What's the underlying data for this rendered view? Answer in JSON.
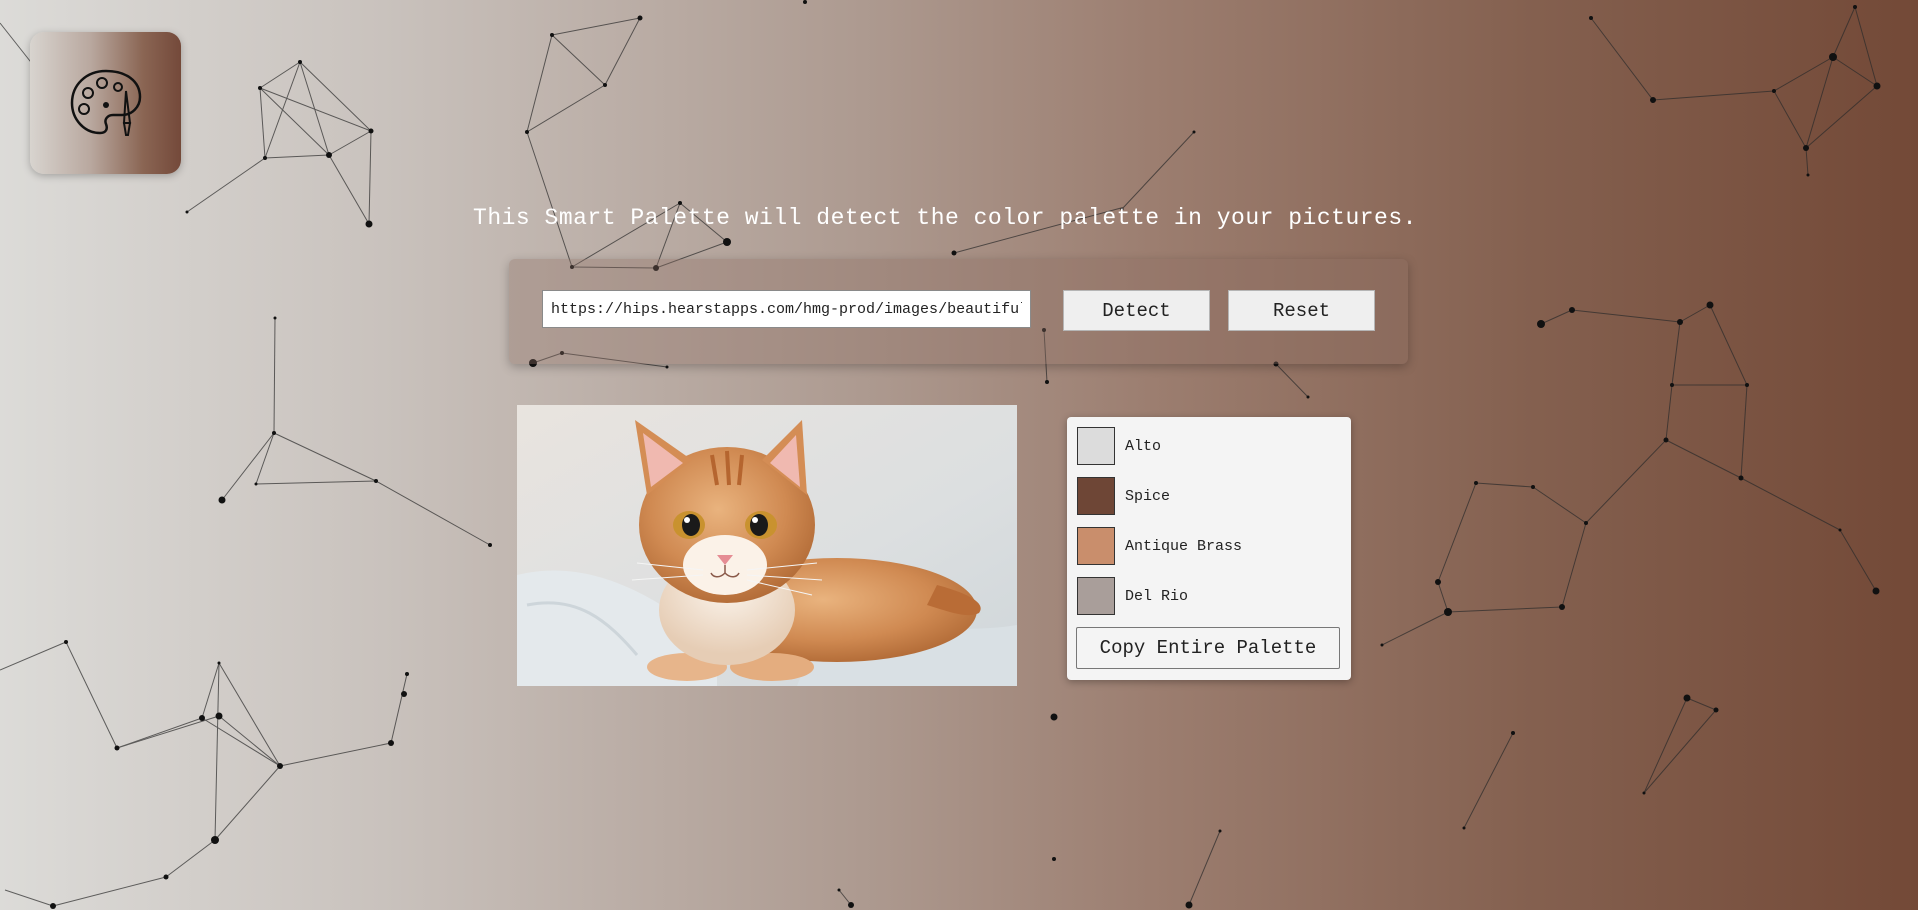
{
  "app": {
    "logo_icon": "palette-icon"
  },
  "headline": "This Smart Palette will detect the color palette in your pictures.",
  "controls": {
    "url_value": "https://hips.hearstapps.com/hmg-prod/images/beautiful-smooth-haired-red-cat-lies-on-the-sofa",
    "detect_label": "Detect",
    "reset_label": "Reset"
  },
  "image": {
    "subject": "orange-tabby-kitten-photo"
  },
  "palette": {
    "colors": [
      {
        "name": "Alto",
        "hex": "#dcdcdc"
      },
      {
        "name": "Spice",
        "hex": "#6e4636"
      },
      {
        "name": "Antique Brass",
        "hex": "#c98e6c"
      },
      {
        "name": "Del Rio",
        "hex": "#a99e9a"
      }
    ],
    "copy_label": "Copy Entire Palette"
  },
  "background": {
    "gradient_start": "#dcdbd8",
    "gradient_end": "#734937"
  }
}
